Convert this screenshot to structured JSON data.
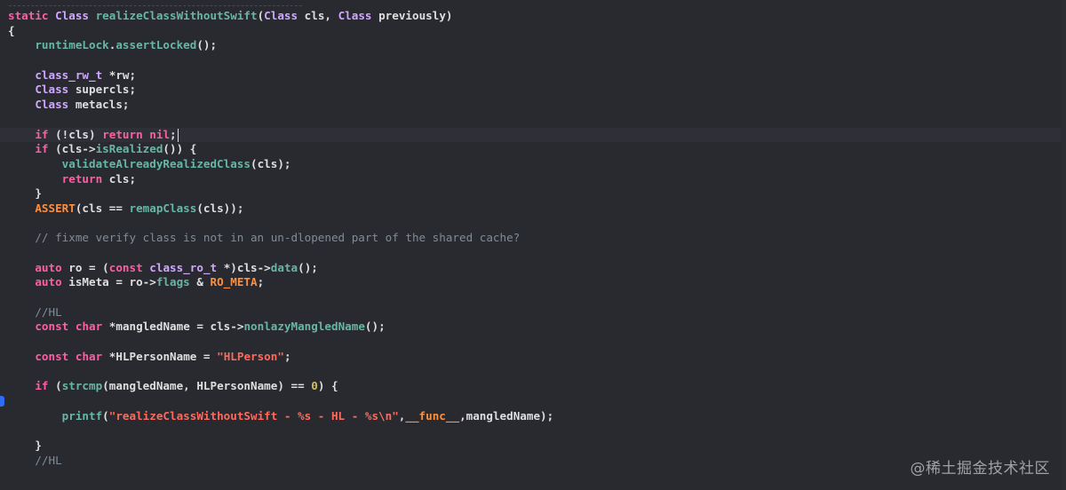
{
  "editor": {
    "cursor_line": 9,
    "breakpoint_line": 27,
    "lines": [
      [
        [
          "kw",
          "static "
        ],
        [
          "type",
          "Class "
        ],
        [
          "fn",
          "realizeClassWithoutSwift"
        ],
        [
          "plain",
          "("
        ],
        [
          "type",
          "Class"
        ],
        [
          "plain",
          " cls, "
        ],
        [
          "type",
          "Class"
        ],
        [
          "plain",
          " previously)"
        ]
      ],
      [
        [
          "plain",
          "{"
        ]
      ],
      [
        [
          "plain",
          "    "
        ],
        [
          "fn",
          "runtimeLock"
        ],
        [
          "plain",
          "."
        ],
        [
          "fn",
          "assertLocked"
        ],
        [
          "plain",
          "();"
        ]
      ],
      [],
      [
        [
          "plain",
          "    "
        ],
        [
          "type",
          "class_rw_t"
        ],
        [
          "plain",
          " *rw;"
        ]
      ],
      [
        [
          "plain",
          "    "
        ],
        [
          "type",
          "Class"
        ],
        [
          "plain",
          " supercls;"
        ]
      ],
      [
        [
          "plain",
          "    "
        ],
        [
          "type",
          "Class"
        ],
        [
          "plain",
          " metacls;"
        ]
      ],
      [],
      [
        [
          "plain",
          "    "
        ],
        [
          "kw",
          "if"
        ],
        [
          "plain",
          " (!cls) "
        ],
        [
          "kw",
          "return"
        ],
        [
          "plain",
          " "
        ],
        [
          "kw",
          "nil"
        ],
        [
          "plain",
          ";"
        ]
      ],
      [
        [
          "plain",
          "    "
        ],
        [
          "kw",
          "if"
        ],
        [
          "plain",
          " (cls->"
        ],
        [
          "fn",
          "isRealized"
        ],
        [
          "plain",
          "()) {"
        ]
      ],
      [
        [
          "plain",
          "        "
        ],
        [
          "fn",
          "validateAlreadyRealizedClass"
        ],
        [
          "plain",
          "(cls);"
        ]
      ],
      [
        [
          "plain",
          "        "
        ],
        [
          "kw",
          "return"
        ],
        [
          "plain",
          " cls;"
        ]
      ],
      [
        [
          "plain",
          "    }"
        ]
      ],
      [
        [
          "plain",
          "    "
        ],
        [
          "macro",
          "ASSERT"
        ],
        [
          "plain",
          "(cls == "
        ],
        [
          "fn",
          "remapClass"
        ],
        [
          "plain",
          "(cls));"
        ]
      ],
      [],
      [
        [
          "plain",
          "    "
        ],
        [
          "cm",
          "// fixme verify class is not in an un-dlopened part of the shared cache?"
        ]
      ],
      [],
      [
        [
          "plain",
          "    "
        ],
        [
          "kw",
          "auto"
        ],
        [
          "plain",
          " ro = ("
        ],
        [
          "kw",
          "const"
        ],
        [
          "plain",
          " "
        ],
        [
          "type",
          "class_ro_t"
        ],
        [
          "plain",
          " *)cls->"
        ],
        [
          "fn",
          "data"
        ],
        [
          "plain",
          "();"
        ]
      ],
      [
        [
          "plain",
          "    "
        ],
        [
          "kw",
          "auto"
        ],
        [
          "plain",
          " isMeta = ro->"
        ],
        [
          "fn",
          "flags"
        ],
        [
          "plain",
          " & "
        ],
        [
          "macro",
          "RO_META"
        ],
        [
          "plain",
          ";"
        ]
      ],
      [],
      [
        [
          "plain",
          "    "
        ],
        [
          "cm",
          "//HL"
        ]
      ],
      [
        [
          "plain",
          "    "
        ],
        [
          "kw",
          "const"
        ],
        [
          "plain",
          " "
        ],
        [
          "kw",
          "char"
        ],
        [
          "plain",
          " *mangledName = cls->"
        ],
        [
          "fn",
          "nonlazyMangledName"
        ],
        [
          "plain",
          "();"
        ]
      ],
      [],
      [
        [
          "plain",
          "    "
        ],
        [
          "kw",
          "const"
        ],
        [
          "plain",
          " "
        ],
        [
          "kw",
          "char"
        ],
        [
          "plain",
          " *HLPersonName = "
        ],
        [
          "str",
          "\"HLPerson\""
        ],
        [
          "plain",
          ";"
        ]
      ],
      [],
      [
        [
          "plain",
          "    "
        ],
        [
          "kw",
          "if"
        ],
        [
          "plain",
          " ("
        ],
        [
          "fn",
          "strcmp"
        ],
        [
          "plain",
          "(mangledName, HLPersonName) == "
        ],
        [
          "num",
          "0"
        ],
        [
          "plain",
          ") {"
        ]
      ],
      [],
      [
        [
          "plain",
          "        "
        ],
        [
          "fn",
          "printf"
        ],
        [
          "plain",
          "("
        ],
        [
          "str",
          "\"realizeClassWithoutSwift - %s - HL - %s\\n\""
        ],
        [
          "plain",
          ","
        ],
        [
          "macro",
          "__func__"
        ],
        [
          "plain",
          ",mangledName);"
        ]
      ],
      [],
      [
        [
          "plain",
          "    }"
        ]
      ],
      [
        [
          "plain",
          "    "
        ],
        [
          "cm",
          "//HL"
        ]
      ]
    ]
  },
  "watermark": {
    "text": "@稀土掘金技术社区"
  }
}
